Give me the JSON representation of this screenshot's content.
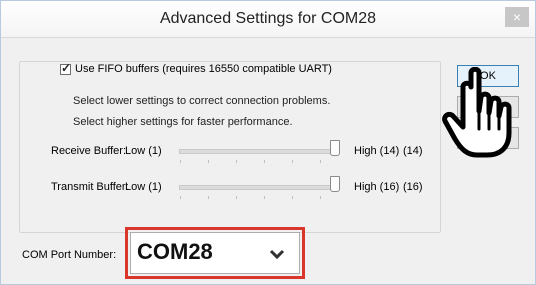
{
  "window": {
    "title": "Advanced Settings for COM28",
    "close_glyph": "×"
  },
  "fifo": {
    "label": "Use FIFO buffers (requires 16550 compatible UART)",
    "checked": true
  },
  "notes": {
    "lower": "Select lower settings to correct connection problems.",
    "higher": "Select higher settings for faster performance."
  },
  "receive": {
    "label": "Receive Buffer:",
    "low": "Low (1)",
    "high": "High (14)",
    "value": "(14)",
    "level": 14,
    "max": 14
  },
  "transmit": {
    "label": "Transmit Buffer:",
    "low": "Low (1)",
    "high": "High (16)",
    "value": "(16)",
    "level": 16,
    "max": 16
  },
  "buttons": {
    "ok": "OK"
  },
  "com_port": {
    "label": "COM Port Number:",
    "value": "COM28"
  },
  "icons": {
    "pointer": "hand-pointer-icon",
    "dropdown": "chevron-down-icon"
  },
  "colors": {
    "highlight": "#d9362c"
  }
}
